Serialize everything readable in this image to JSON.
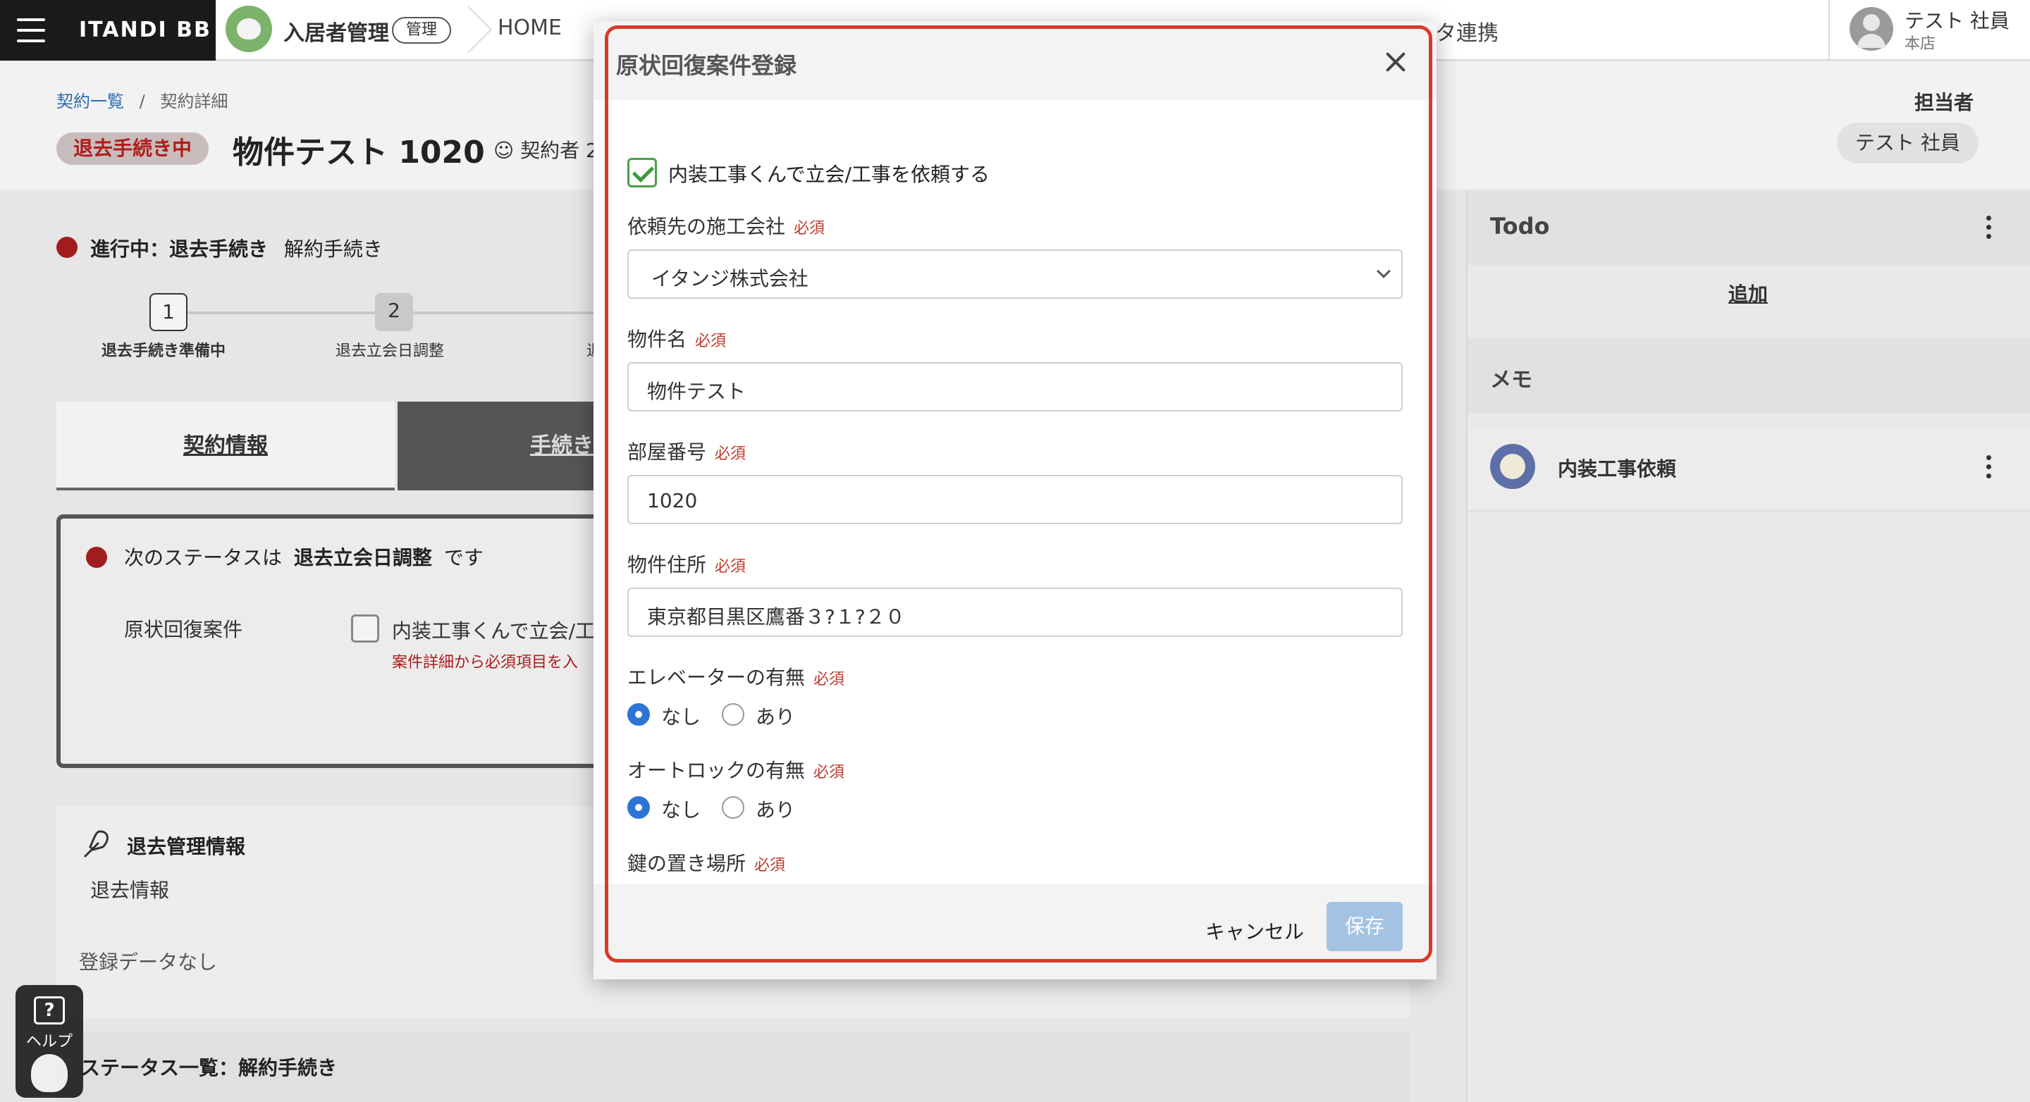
{
  "topbar": {
    "brand": "ITANDI BB",
    "app_name": "入居者管理",
    "app_badge": "管理",
    "nav_home": "HOME",
    "nav_partial": "タ連携",
    "user_name": "テスト 社員",
    "user_branch": "本店"
  },
  "header": {
    "breadcrumb_list": "契約一覧",
    "breadcrumb_sep": "/",
    "breadcrumb_current": "契約詳細",
    "status": "退去手続き中",
    "title": "物件テスト 1020",
    "contractor": "契約者 2",
    "assignee_label": "担当者",
    "assignee_name": "テスト 社員"
  },
  "progress": {
    "label_bold": "進行中：退去手続き",
    "label_rest": "解約手続き",
    "steps": [
      {
        "num": "1",
        "label": "退去手続き準備中"
      },
      {
        "num": "2",
        "label": "退去立会日調整"
      }
    ],
    "step3_partial": "退"
  },
  "tabs": {
    "contract": "契約情報",
    "procedure": "手続き"
  },
  "status_card": {
    "prefix": "次のステータスは",
    "next_status": "退去立会日調整",
    "suffix": "です",
    "row_label": "原状回復案件",
    "checkbox_label": "内装工事くんで立会/工",
    "warning": "案件詳細から必須項目を入"
  },
  "mgmt": {
    "title": "退去管理情報",
    "sub": "退去情報",
    "empty": "登録データなし"
  },
  "status_list": {
    "title": "ステータス一覧：解約手続き"
  },
  "right": {
    "todo_title": "Todo",
    "todo_add": "追加",
    "memo_title": "メモ",
    "memo_item": "内装工事依頼"
  },
  "help": {
    "icon": "?",
    "label": "ヘルプ"
  },
  "modal": {
    "title": "原状回復案件登録",
    "request_checkbox_label": "内装工事くんで立会/工事を依頼する",
    "required_tag": "必須",
    "fields": {
      "company_label": "依頼先の施工会社",
      "company_value": "イタンジ株式会社",
      "property_label": "物件名",
      "property_value": "物件テスト",
      "room_label": "部屋番号",
      "room_value": "1020",
      "address_label": "物件住所",
      "address_value": "東京都目黒区鷹番３?１?２０",
      "elevator_label": "エレベーターの有無",
      "autolock_label": "オートロックの有無",
      "key_label": "鍵の置き場所"
    },
    "radio_none": "なし",
    "radio_yes": "あり",
    "cancel": "キャンセル",
    "save": "保存"
  }
}
